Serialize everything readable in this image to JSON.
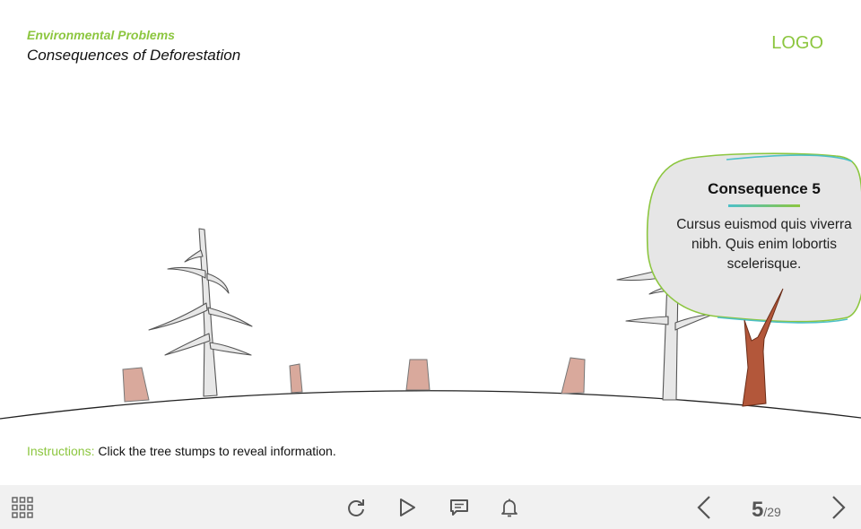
{
  "header": {
    "course_title": "Environmental Problems",
    "slide_title": "Consequences of Deforestation",
    "logo": "LOGO"
  },
  "callout": {
    "title": "Consequence 5",
    "body": "Cursus euismod quis viverra nibh. Quis enim lobortis scelerisque."
  },
  "instructions": {
    "label": "Instructions:",
    "text": "Click the tree stumps to reveal information."
  },
  "toolbar": {
    "icons": [
      "menu-grid-icon",
      "replay-icon",
      "play-icon",
      "comment-icon",
      "bell-icon",
      "prev-icon",
      "next-icon"
    ],
    "current_page": "5",
    "total_pages": "/29"
  },
  "colors": {
    "accent": "#8cc63f",
    "accent_secondary": "#4dc0c8",
    "stump": "#d9a99c",
    "tree_trunk": "#b3573a",
    "toolbar_bg": "#f1f1f1"
  }
}
